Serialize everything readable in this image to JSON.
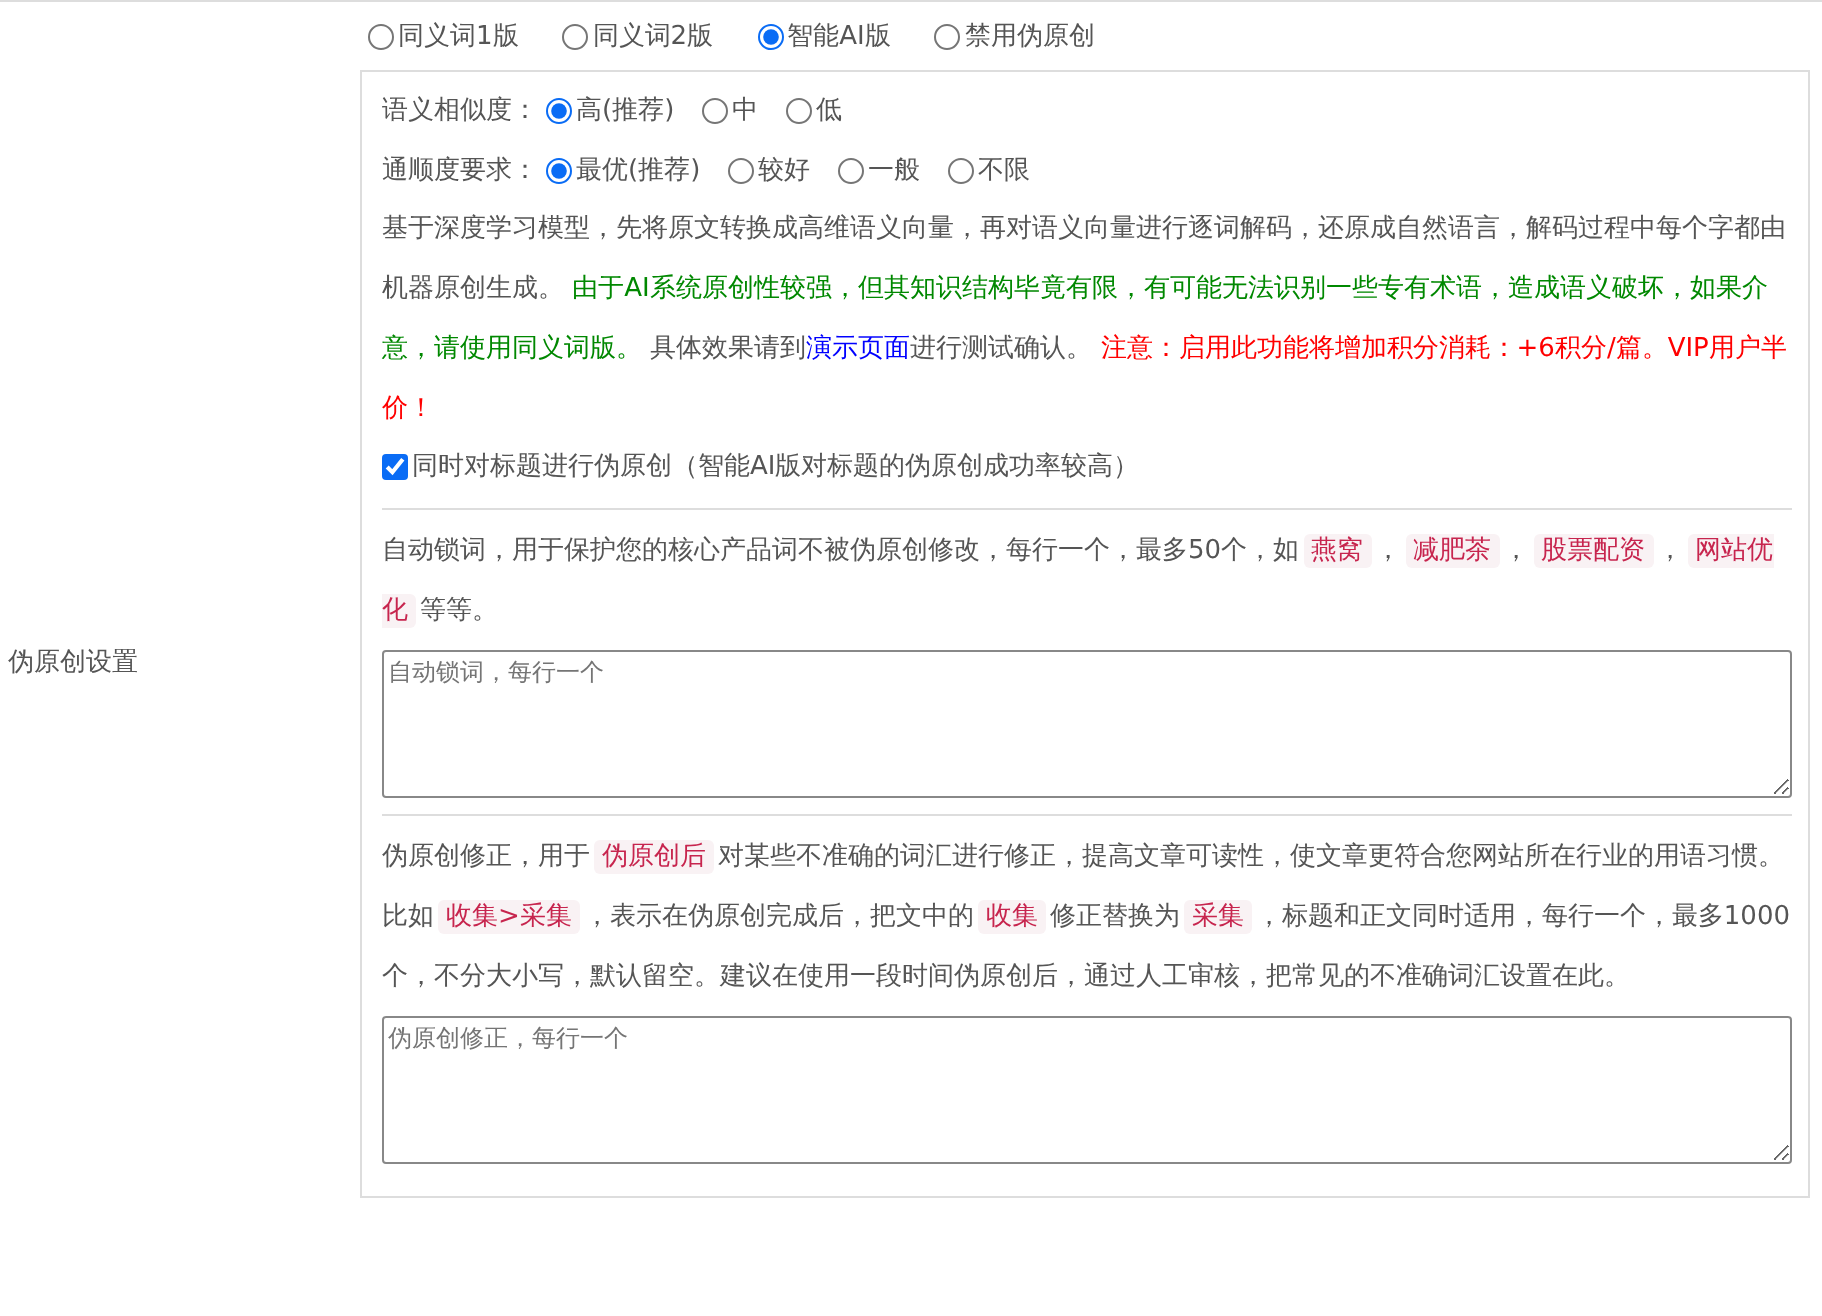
{
  "section_label": "伪原创设置",
  "modes": [
    {
      "label": "同义词1版",
      "selected": false
    },
    {
      "label": "同义词2版",
      "selected": false
    },
    {
      "label": "智能AI版",
      "selected": true
    },
    {
      "label": "禁用伪原创",
      "selected": false
    }
  ],
  "similarity": {
    "label": "语义相似度：",
    "options": [
      {
        "label": "高(推荐)",
        "selected": true
      },
      {
        "label": "中",
        "selected": false
      },
      {
        "label": "低",
        "selected": false
      }
    ]
  },
  "fluency": {
    "label": "通顺度要求：",
    "options": [
      {
        "label": "最优(推荐)",
        "selected": true
      },
      {
        "label": "较好",
        "selected": false
      },
      {
        "label": "一般",
        "selected": false
      },
      {
        "label": "不限",
        "selected": false
      }
    ]
  },
  "ai_description": [
    {
      "kind": "plain",
      "text": "基于深度学习模型，先将原文转换成高维语义向量，再对语义向量进行逐词解码，还原成自然语言，解码过程中每个字都由机器原创生成。 "
    },
    {
      "kind": "note",
      "text": "由于AI系统原创性较强，但其知识结构毕竟有限，有可能无法识别一些专有术语，造成语义破坏，如果介意，请使用同义词版。"
    },
    {
      "kind": "plain",
      "text": " 具体效果请到"
    },
    {
      "kind": "link",
      "text": "演示页面"
    },
    {
      "kind": "plain",
      "text": "进行测试确认。 "
    },
    {
      "kind": "warning",
      "text": "注意：启用此功能将增加积分消耗：+6积分/篇。VIP用户半价！"
    }
  ],
  "title_option": {
    "label": "同时对标题进行伪原创（智能AI版对标题的伪原创成功率较高）",
    "checked": true
  },
  "lock_words": {
    "description": [
      {
        "kind": "plain",
        "text": "自动锁词，用于保护您的核心产品词不被伪原创修改，每行一个，最多50个，如"
      },
      {
        "kind": "tag",
        "text": "燕窝"
      },
      {
        "kind": "plain",
        "text": "，"
      },
      {
        "kind": "tag",
        "text": "减肥茶"
      },
      {
        "kind": "plain",
        "text": "，"
      },
      {
        "kind": "tag",
        "text": "股票配资"
      },
      {
        "kind": "plain",
        "text": "，"
      },
      {
        "kind": "tag",
        "text": "网站优化"
      },
      {
        "kind": "plain",
        "text": "等等。"
      }
    ],
    "placeholder": "自动锁词，每行一个"
  },
  "corrections": {
    "description": [
      {
        "kind": "plain",
        "text": "伪原创修正，用于"
      },
      {
        "kind": "tag",
        "text": "伪原创后"
      },
      {
        "kind": "plain",
        "text": "对某些不准确的词汇进行修正，提高文章可读性，使文章更符合您网站所在行业的用语习惯。比如"
      },
      {
        "kind": "tag",
        "text": "收集>采集"
      },
      {
        "kind": "plain",
        "text": "，表示在伪原创完成后，把文中的"
      },
      {
        "kind": "tag",
        "text": "收集"
      },
      {
        "kind": "plain",
        "text": "修正替换为"
      },
      {
        "kind": "tag",
        "text": "采集"
      },
      {
        "kind": "plain",
        "text": "，标题和正文同时适用，每行一个，最多1000个，不分大小写，默认留空。建议在使用一段时间伪原创后，通过人工审核，把常见的不准确词汇设置在此。"
      }
    ],
    "placeholder": "伪原创修正，每行一个"
  }
}
